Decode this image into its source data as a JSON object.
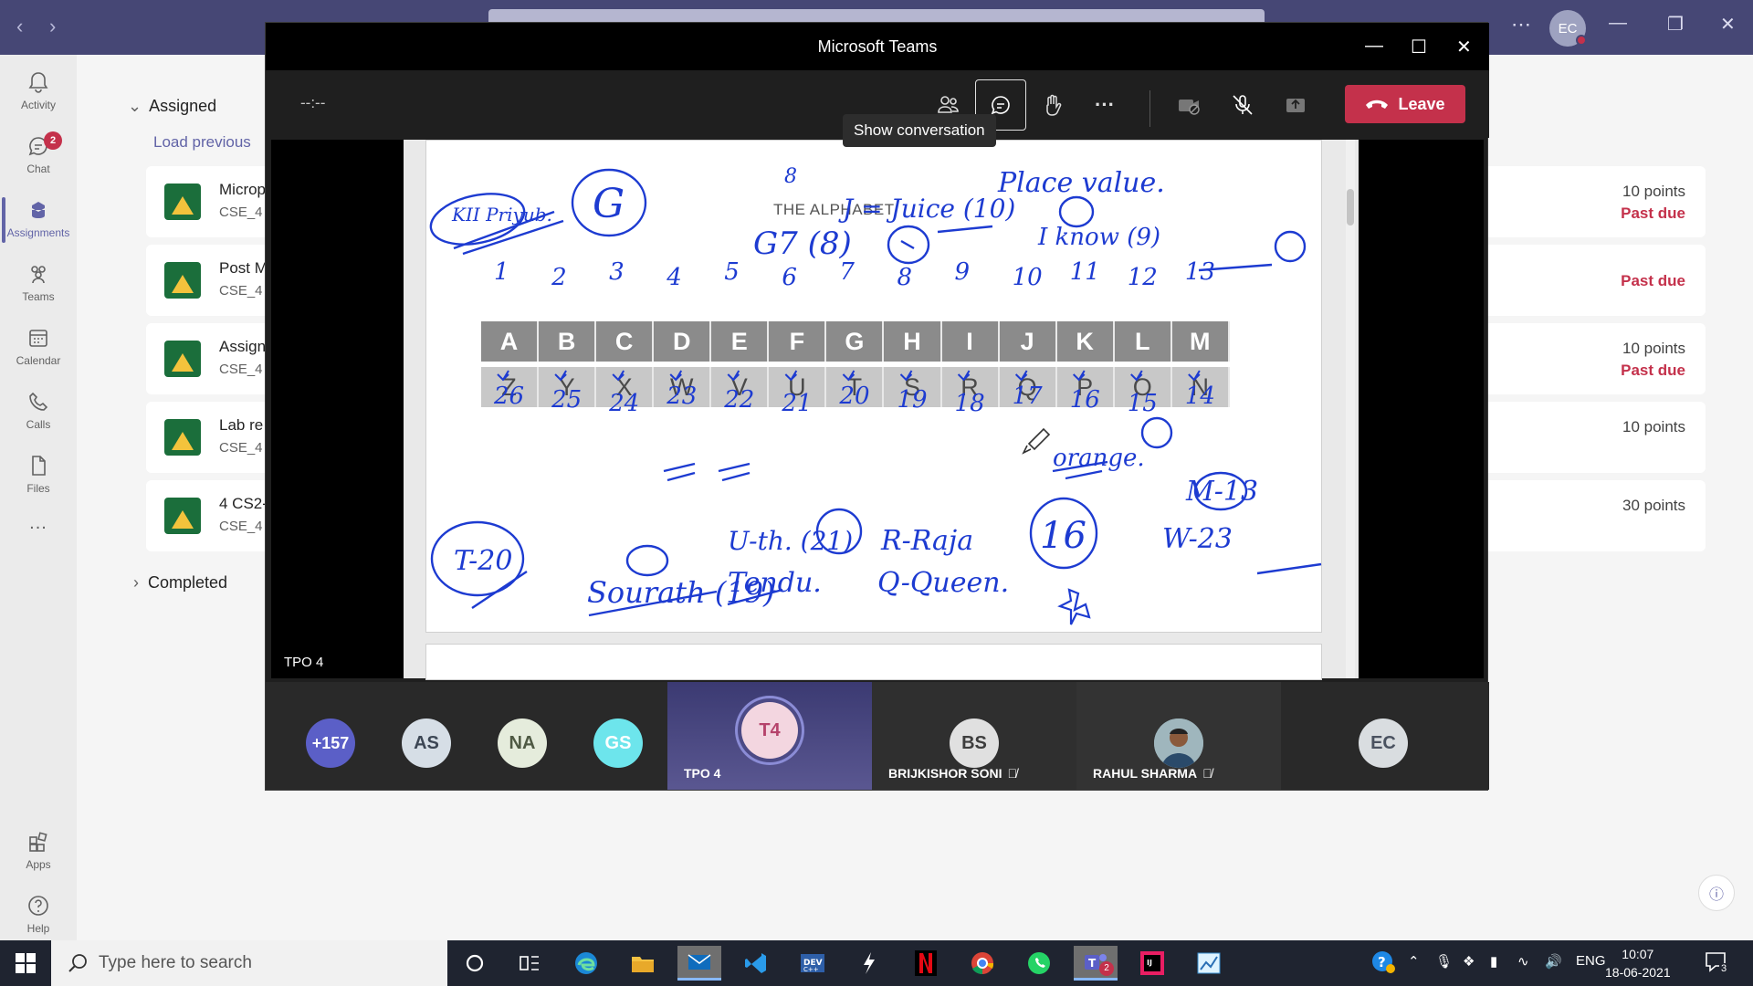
{
  "teams_window": {
    "search_placeholder": "Search",
    "user_initials": "EC"
  },
  "rail": {
    "items": [
      {
        "label": "Activity",
        "icon": "bell-icon"
      },
      {
        "label": "Chat",
        "icon": "chat-icon",
        "badge": "2"
      },
      {
        "label": "Assignments",
        "icon": "assignments-icon"
      },
      {
        "label": "Teams",
        "icon": "teams-icon"
      },
      {
        "label": "Calendar",
        "icon": "calendar-icon"
      },
      {
        "label": "Calls",
        "icon": "phone-icon"
      },
      {
        "label": "Files",
        "icon": "file-icon"
      },
      {
        "label": "Apps",
        "icon": "apps-icon"
      },
      {
        "label": "Help",
        "icon": "help-icon"
      }
    ],
    "more": "..."
  },
  "assignments": {
    "assigned_label": "Assigned",
    "load_previous": "Load previous",
    "completed_label": "Completed",
    "cards": [
      {
        "title": "Microp",
        "class": "CSE_4",
        "points": "10 points",
        "status": "Past due"
      },
      {
        "title": "Post M",
        "class": "CSE_4",
        "points": "",
        "status": "Past due"
      },
      {
        "title": "Assign",
        "class": "CSE_4",
        "points": "10 points",
        "status": "Past due"
      },
      {
        "title": "Lab re",
        "class": "CSE_4",
        "points": "10 points",
        "status": ""
      },
      {
        "title": "4 CS2-",
        "class": "CSE_4",
        "points": "30 points",
        "status": ""
      }
    ]
  },
  "meeting": {
    "window_title": "Microsoft Teams",
    "timer": "--:--",
    "tooltip": "Show conversation",
    "leave_label": "Leave",
    "presenter_label": "TPO 4",
    "content": {
      "title": "THE ALPHABET",
      "numbers": [
        "1",
        "2",
        "3",
        "4",
        "5",
        "6",
        "7",
        "8",
        "9",
        "10",
        "11",
        "12",
        "13"
      ],
      "top_row": [
        "A",
        "B",
        "C",
        "D",
        "E",
        "F",
        "G",
        "H",
        "I",
        "J",
        "K",
        "L",
        "M"
      ],
      "bottom_row": [
        "Z",
        "Y",
        "X",
        "W",
        "V",
        "U",
        "T",
        "S",
        "R",
        "Q",
        "P",
        "O",
        "N"
      ],
      "bottom_numbers": [
        "26",
        "25",
        "24",
        "23",
        "22",
        "21",
        "20",
        "19",
        "18",
        "17",
        "16",
        "15",
        "14"
      ],
      "notes": {
        "top_left": "KII Priyub.",
        "circled_g": "G",
        "eight": "8",
        "g_equals": "G7 (8)",
        "j_equals": "J = Juice (10)",
        "place_value": "Place value.",
        "i_know": "I know (9)",
        "orange": "orange.",
        "t_twenty": "T-20",
        "sourath": "Sourath (19)",
        "tendu": "Tendu.",
        "u_ath": "U-th. (21)",
        "r_raja": "R-Raja",
        "q_queen": "Q-Queen.",
        "sixteen": "16",
        "m13": "M-13",
        "w23": "W-23"
      }
    },
    "participants": {
      "overflow": "+157",
      "avatars": [
        {
          "initials": "AS",
          "bg": "#d6dee6",
          "fg": "#3c4654"
        },
        {
          "initials": "NA",
          "bg": "#e5ecdc",
          "fg": "#4f5a44"
        },
        {
          "initials": "GS",
          "bg": "#6de5ec",
          "fg": "#ffffff"
        }
      ],
      "tiles": [
        {
          "initials": "T4",
          "name": "TPO 4",
          "muted": false
        },
        {
          "initials": "BS",
          "name": "BRIJKISHOR SONI",
          "muted": true
        },
        {
          "initials": "",
          "name": "RAHUL SHARMA",
          "muted": true
        }
      ],
      "self": "EC"
    }
  },
  "taskbar": {
    "search_placeholder": "Type here to search",
    "language": "ENG",
    "time": "10:07",
    "date": "18-06-2021",
    "notifications": "3",
    "teams_badge": "2"
  },
  "colors": {
    "teams_purple": "#464775",
    "accent": "#6264a7",
    "leave_red": "#c4314b",
    "ink_blue": "#1d3bd1"
  }
}
